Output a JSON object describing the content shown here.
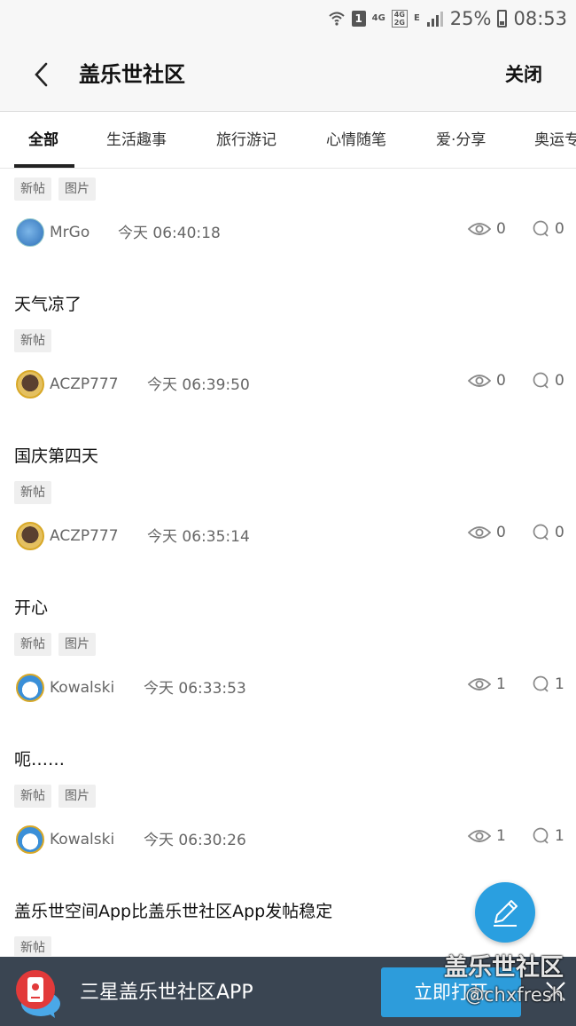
{
  "status_bar": {
    "sim_slot": "1",
    "net_primary": "4G",
    "net_stack_top": "4G",
    "net_stack_bottom": "2G",
    "net_small": "E",
    "battery": "25%",
    "time": "08:53"
  },
  "header": {
    "title": "盖乐世社区",
    "close_label": "关闭"
  },
  "tabs": [
    {
      "label": "全部",
      "active": true
    },
    {
      "label": "生活趣事"
    },
    {
      "label": "旅行游记"
    },
    {
      "label": "心情随笔"
    },
    {
      "label": "爱·分享"
    },
    {
      "label": "奥运专"
    }
  ],
  "posts": [
    {
      "title": "",
      "tags": [
        "新帖",
        "图片"
      ],
      "user": "MrGo",
      "time": "今天 06:40:18",
      "views": "0",
      "comments": "0"
    },
    {
      "title": "天气凉了",
      "tags": [
        "新帖"
      ],
      "user": "ACZP777",
      "time": "今天 06:39:50",
      "views": "0",
      "comments": "0"
    },
    {
      "title": "国庆第四天",
      "tags": [
        "新帖"
      ],
      "user": "ACZP777",
      "time": "今天 06:35:14",
      "views": "0",
      "comments": "0"
    },
    {
      "title": "开心",
      "tags": [
        "新帖",
        "图片"
      ],
      "user": "Kowalski",
      "time": "今天 06:33:53",
      "views": "1",
      "comments": "1"
    },
    {
      "title": "呃……",
      "tags": [
        "新帖",
        "图片"
      ],
      "user": "Kowalski",
      "time": "今天 06:30:26",
      "views": "1",
      "comments": "1"
    },
    {
      "title": "盖乐世空间App比盖乐世社区App发帖稳定",
      "tags": [
        "新帖"
      ],
      "user": "",
      "time": "",
      "views": "",
      "comments": ""
    }
  ],
  "banner": {
    "text": "三星盖乐世社区APP",
    "open_label": "立即打开"
  },
  "watermark": {
    "line1": "盖乐世社区",
    "line2": "@chxfresh"
  },
  "colors": {
    "accent": "#2a9fe0",
    "banner_bg": "#3a4552",
    "open_button": "#2d9cdb"
  }
}
